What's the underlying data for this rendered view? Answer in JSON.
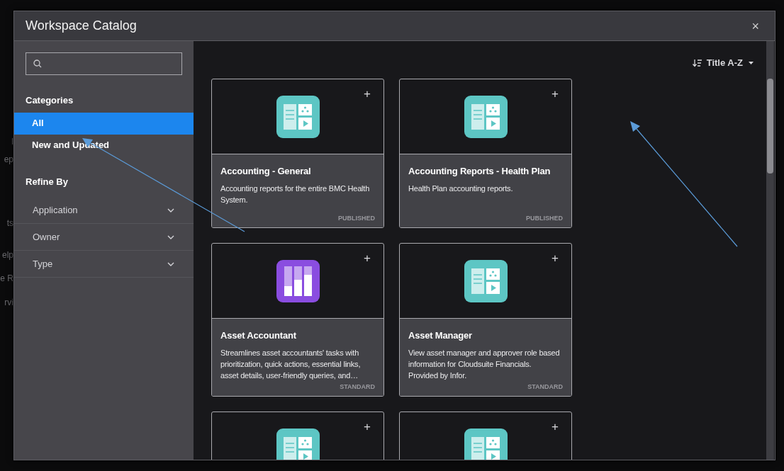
{
  "background_fragments": [
    "l",
    "ep",
    "ts",
    "elp",
    "e R",
    "rvi"
  ],
  "window": {
    "title": "Workspace Catalog",
    "close": "×"
  },
  "sidebar": {
    "categories_heading": "Categories",
    "categories": [
      {
        "label": "All",
        "selected": true
      },
      {
        "label": "New and Updated",
        "selected": false
      }
    ],
    "refine_heading": "Refine By",
    "filters": [
      {
        "label": "Application",
        "expanded": false
      },
      {
        "label": "Owner",
        "expanded": false
      },
      {
        "label": "Type",
        "expanded": false
      }
    ]
  },
  "sort": {
    "label": "Title A-Z"
  },
  "cards": [
    {
      "kind": "dashboard",
      "title": "Accounting - General",
      "description": "Accounting reports for the entire BMC Health System.",
      "status": "PUBLISHED"
    },
    {
      "kind": "dashboard",
      "title": "Accounting Reports - Health Plan",
      "description": "Health Plan accounting reports.",
      "status": "PUBLISHED"
    },
    {
      "kind": "chart",
      "title": "Asset Accountant",
      "description": "Streamlines asset accountants' tasks with prioritization, quick actions, essential links, asset details, user-friendly queries, and…",
      "status": "STANDARD"
    },
    {
      "kind": "dashboard",
      "title": "Asset Manager",
      "description": "View asset manager and approver role based information for Cloudsuite Financials. Provided by Infor.",
      "status": "STANDARD"
    },
    {
      "kind": "dashboard"
    },
    {
      "kind": "dashboard"
    }
  ],
  "add_symbol": "+"
}
